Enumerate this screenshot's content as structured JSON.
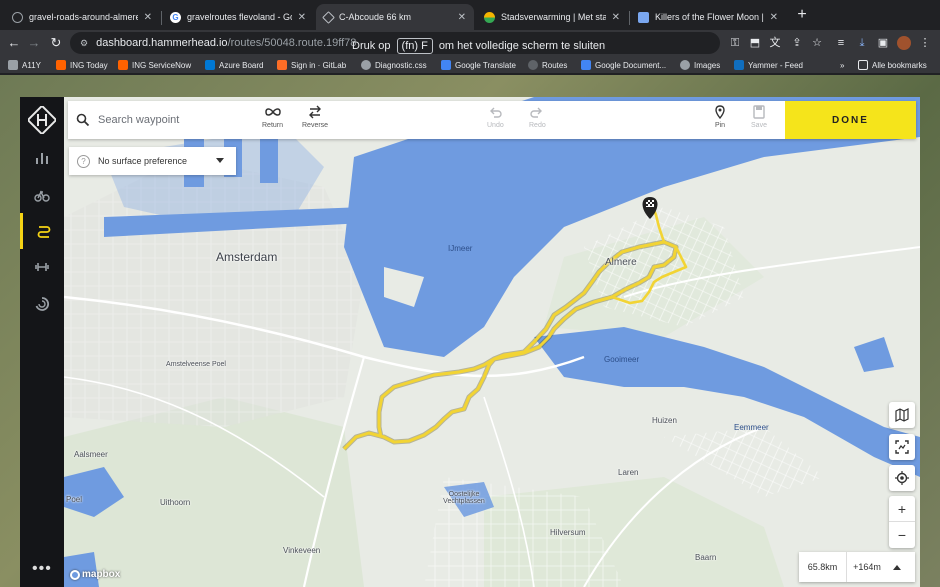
{
  "tabs": [
    {
      "title": "gravel-roads-around-almere-",
      "favicon_color": "#5f6368"
    },
    {
      "title": "gravelroutes flevoland - Goog",
      "favicon_color": "#4285f4"
    },
    {
      "title": "C-Abcoude 66 km",
      "favicon_color": "#5f6368"
    },
    {
      "title": "Stadsverwarming | Met stadsv",
      "favicon_color": "#f4b400"
    },
    {
      "title": "Killers of the Flower Moon | Ki",
      "favicon_color": "#7aa7f0"
    }
  ],
  "url": {
    "host": "dashboard.hammerhead.io",
    "path": "/routes/50048.route.19ff78"
  },
  "fullscreen_toast": {
    "before": "Druk op",
    "key": "(fn) F",
    "after": "om het volledige scherm te sluiten"
  },
  "bookmarks": [
    {
      "label": "A11Y",
      "color": "#9aa0a6"
    },
    {
      "label": "ING Today",
      "color": "#ff6200"
    },
    {
      "label": "ING ServiceNow",
      "color": "#ff6200"
    },
    {
      "label": "Azure Board",
      "color": "#0078d4"
    },
    {
      "label": "Sign in · GitLab",
      "color": "#fc6d26"
    },
    {
      "label": "Diagnostic.css",
      "color": "#9aa0a6"
    },
    {
      "label": "Google Translate",
      "color": "#4285f4"
    },
    {
      "label": "Routes",
      "color": "#5f6368"
    },
    {
      "label": "Google Document...",
      "color": "#4285f4"
    },
    {
      "label": "Images",
      "color": "#9aa0a6"
    },
    {
      "label": "Yammer - Feed",
      "color": "#106ebe"
    }
  ],
  "bookmarks_more": "»",
  "all_bookmarks": "Alle bookmarks",
  "search": {
    "placeholder": "Search waypoint"
  },
  "tools": {
    "return": "Return",
    "reverse": "Reverse",
    "undo": "Undo",
    "redo": "Redo",
    "pin": "Pin",
    "save": "Save"
  },
  "done_label": "DONE",
  "surface_preference": "No surface preference",
  "map_labels": {
    "amsterdam": "Amsterdam",
    "almere": "Almere",
    "ijmeer": "IJmeer",
    "gooimeer": "Gooimeer",
    "eemmeer": "Eemmeer",
    "huizen": "Huizen",
    "laren": "Laren",
    "hilversum": "Hilversum",
    "baarn": "Baarn",
    "uithoorn": "Uithoorn",
    "vinkeveen": "Vinkeveen",
    "aalsmeer": "Aalsmeer",
    "poel": "Poel",
    "amstelveen": "Amstelveense Poel",
    "oostelijke": "Oostelijke Vechtplassen"
  },
  "stats": {
    "distance": "65.8km",
    "elevation": "+164m"
  },
  "mapbox": "mapbox",
  "colors": {
    "route": "#f2d434",
    "water": "#6f9be0",
    "done": "#f5e41b",
    "rail_active": "#f5d315"
  }
}
